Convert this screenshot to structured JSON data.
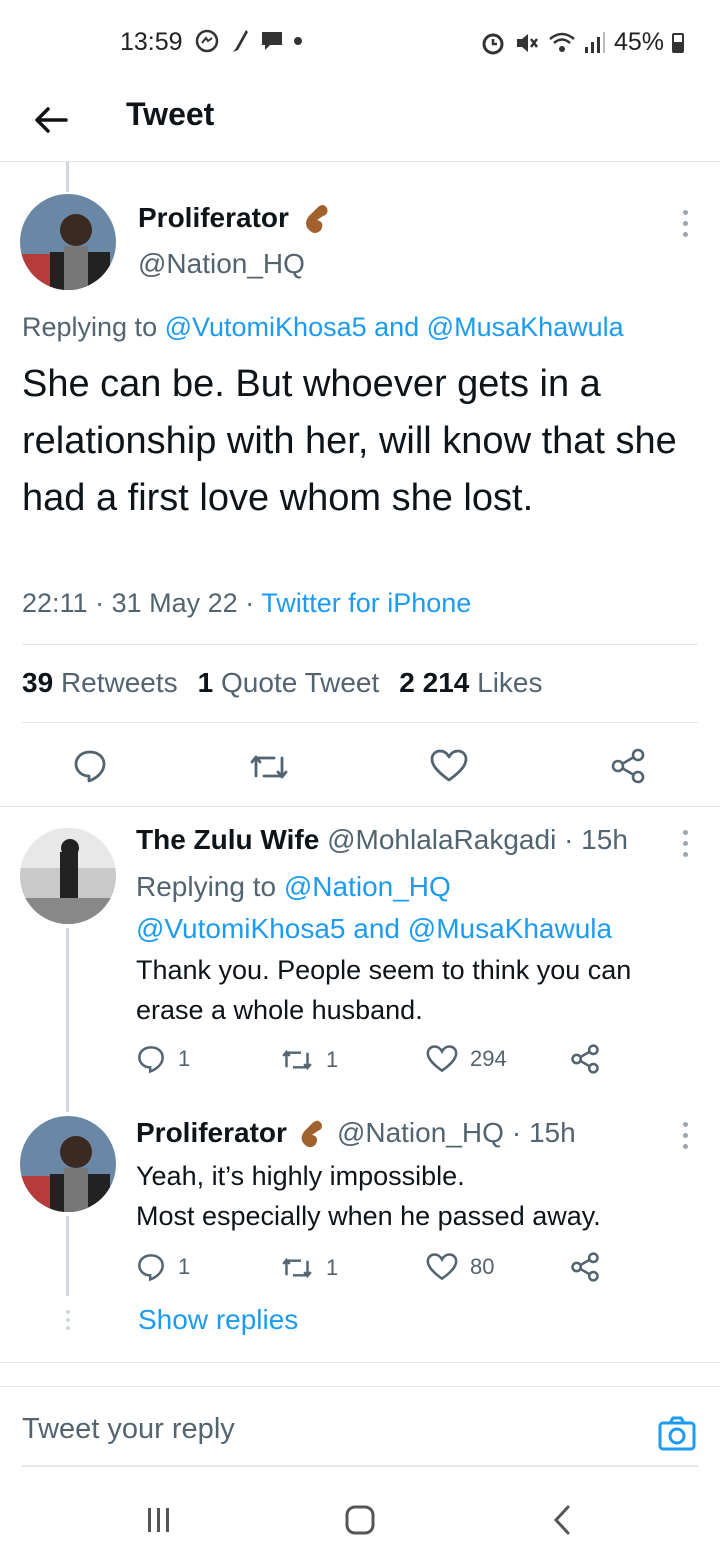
{
  "status_bar": {
    "time": "13:59",
    "battery": "45%"
  },
  "header": {
    "title": "Tweet"
  },
  "main_tweet": {
    "name": "Proliferator",
    "handle": "@Nation_HQ",
    "replying_prefix": "Replying to",
    "replying_users": "@VutomiKhosa5 and @MusaKhawula",
    "text": "She can be. But whoever gets in a relationship with her, will know that she had a first love whom she lost.",
    "time": "22:11",
    "date": "31 May 22",
    "source": "Twitter for iPhone",
    "separator": "·",
    "retweets_count": "39",
    "retweets_label": "Retweets",
    "quotes_count": "1",
    "quotes_label": "Quote Tweet",
    "likes_count": "2 214",
    "likes_label": "Likes"
  },
  "replies": [
    {
      "name": "The Zulu Wife",
      "handle": "@MohlalaRakgadi",
      "age": "· 15h",
      "replying_prefix": "Replying to",
      "replying_first": "@Nation_HQ",
      "replying_rest": "@VutomiKhosa5 and @MusaKhawula",
      "text": "Thank you. People seem to think you can erase a whole husband.",
      "reply_count": "1",
      "retweet_count": "1",
      "like_count": "294"
    },
    {
      "name": "Proliferator",
      "handle": "@Nation_HQ",
      "age": "· 15h",
      "text_line1": "Yeah, it’s highly impossible.",
      "text_line2": "Most especially when he passed away.",
      "reply_count": "1",
      "retweet_count": "1",
      "like_count": "80",
      "show_replies": "Show replies"
    }
  ],
  "reply_bar": {
    "placeholder": "Tweet your reply"
  },
  "colors": {
    "accent": "#1d9bf0",
    "text": "#0f1419",
    "secondary": "#536471"
  }
}
